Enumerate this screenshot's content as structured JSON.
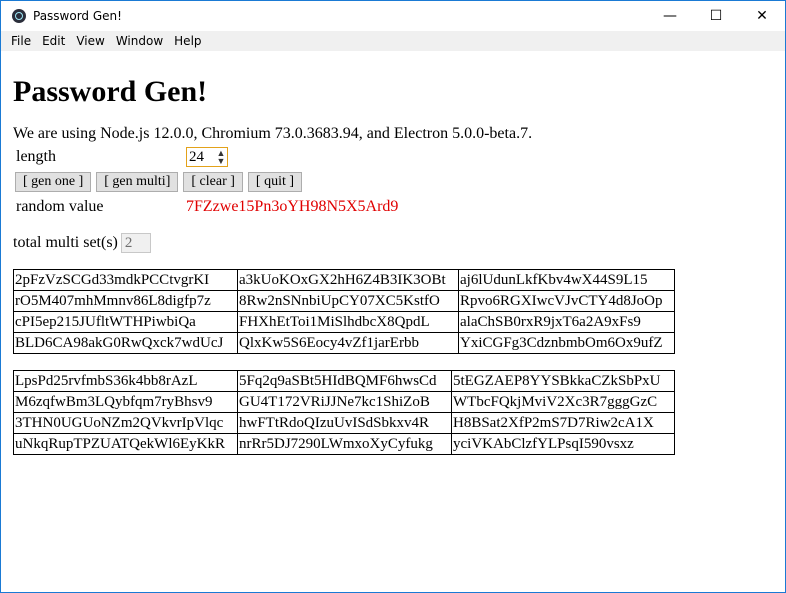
{
  "window": {
    "title": "Password Gen!"
  },
  "controls": {
    "minimize": "—",
    "maximize": "☐",
    "close": "✕"
  },
  "menu": [
    "File",
    "Edit",
    "View",
    "Window",
    "Help"
  ],
  "heading": "Password Gen!",
  "info": "We are using Node.js 12.0.0, Chromium 73.0.3683.94, and Electron 5.0.0-beta.7.",
  "length": {
    "label": "length",
    "value": "24"
  },
  "buttons": {
    "gen_one": "[ gen one ]",
    "gen_multi": "[ gen multi]",
    "clear": "[ clear ]",
    "quit": "[ quit ]"
  },
  "random": {
    "label": "random value",
    "value": "7FZzwe15Pn3oYH98N5X5Ard9"
  },
  "multi": {
    "label": "total multi set(s)",
    "value": "2"
  },
  "sets": [
    [
      [
        "2pFzVzSCGd33mdkPCCtvgrKI",
        "a3kUoKOxGX2hH6Z4B3IK3OBt",
        "aj6lUdunLkfKbv4wX44S9L15"
      ],
      [
        "rO5M407mhMmnv86L8digfp7z",
        "8Rw2nSNnbiUpCY07XC5KstfO",
        "Rpvo6RGXIwcVJvCTY4d8JoOp"
      ],
      [
        "cPI5ep215JUfltWTHPiwbiQa",
        "FHXhEtToi1MiSlhdbcX8QpdL",
        "alaChSB0rxR9jxT6a2A9xFs9"
      ],
      [
        "BLD6CA98akG0RwQxck7wdUcJ",
        "QlxKw5S6Eocy4vZf1jarErbb",
        "YxiCGFg3CdznbmbOm6Ox9ufZ"
      ]
    ],
    [
      [
        "LpsPd25rvfmbS36k4bb8rAzL",
        "5Fq2q9aSBt5HIdBQMF6hwsCd",
        "5tEGZAEP8YYSBkkaCZkSbPxU"
      ],
      [
        "M6zqfwBm3LQybfqm7ryBhsv9",
        "GU4T172VRiJJNe7kc1ShiZoB",
        "WTbcFQkjMviV2Xc3R7gggGzC"
      ],
      [
        "3THN0UGUoNZm2QVkvrIpVlqc",
        "hwFTtRdoQIzuUvISdSbkxv4R",
        "H8BSat2XfP2mS7D7Riw2cA1X"
      ],
      [
        "uNkqRupTPZUATQekWl6EyKkR",
        "nrRr5DJ7290LWmxoXyCyfukg",
        "yciVKAbClzfYLPsqI590vsxz"
      ]
    ]
  ]
}
